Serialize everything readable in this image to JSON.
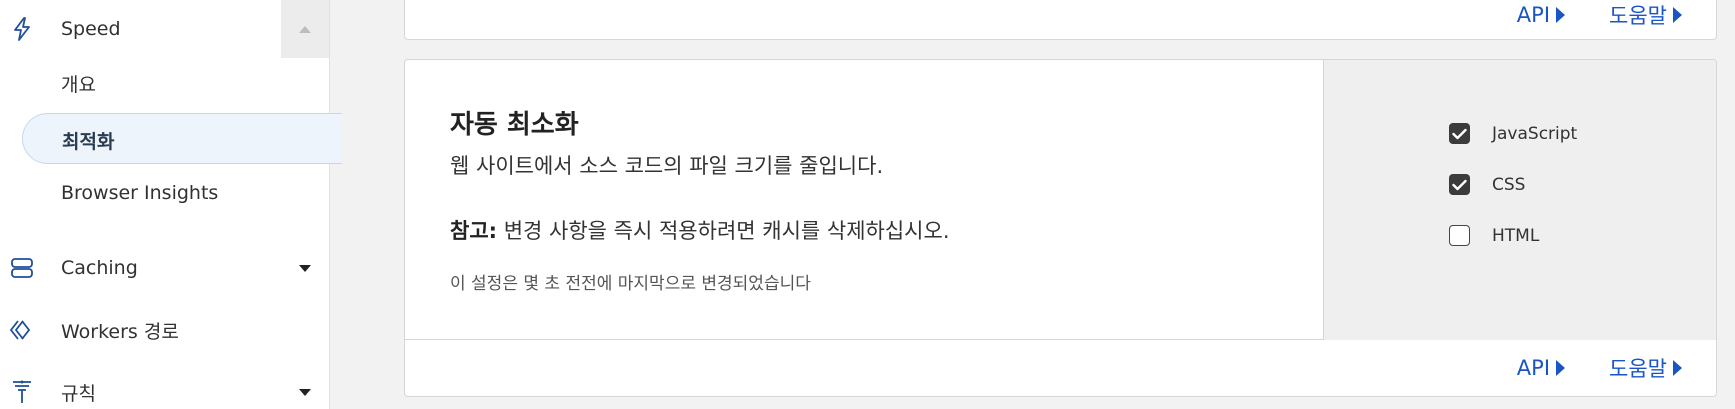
{
  "sidebar": {
    "speed": {
      "label": "Speed",
      "icon": "lightning-icon"
    },
    "sub_items": [
      {
        "label": "개요"
      },
      {
        "label": "최적화"
      },
      {
        "label": "Browser Insights"
      }
    ],
    "caching": {
      "label": "Caching",
      "icon": "database-icon"
    },
    "workers": {
      "label": "Workers 경로",
      "icon": "workers-icon"
    },
    "rules": {
      "label": "규칙",
      "icon": "funnel-icon"
    }
  },
  "top_card": {
    "api_label": "API",
    "help_label": "도움말"
  },
  "auto_minify": {
    "title": "자동 최소화",
    "description": "웹 사이트에서 소스 코드의 파일 크기를 줄입니다.",
    "note_prefix": "참고:",
    "note_text": " 변경 사항을 즉시 적용하려면 캐시를 삭제하십시오.",
    "meta": "이 설정은 몇 초 전전에 마지막으로 변경되었습니다",
    "options": [
      {
        "label": "JavaScript",
        "checked": true
      },
      {
        "label": "CSS",
        "checked": true
      },
      {
        "label": "HTML",
        "checked": false
      }
    ],
    "api_label": "API",
    "help_label": "도움말"
  },
  "colors": {
    "link": "#1a55c4",
    "active_bg": "#eef4fb",
    "checkbox": "#3b3b3b"
  }
}
